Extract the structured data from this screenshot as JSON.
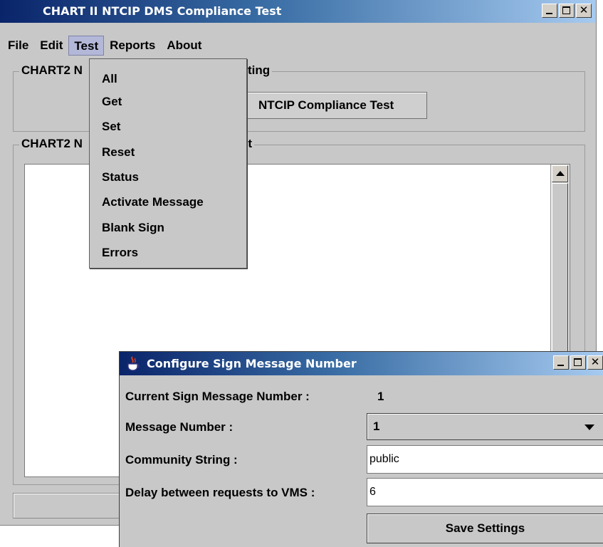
{
  "main_window": {
    "title": "CHART II NTCIP DMS Compliance Test",
    "window_controls": {
      "minimize_icon": "minimize-icon",
      "maximize_icon": "maximize-icon",
      "close_glyph": "✕"
    },
    "menubar": {
      "file": "File",
      "edit": "Edit",
      "test": "Test",
      "reports": "Reports",
      "about": "About"
    },
    "test_group_legend": "CHART2 N",
    "test_group_legend_suffix": "Testing",
    "run_button_label": "NTCIP Compliance Test",
    "output_group_legend": "CHART2 N",
    "output_group_legend_suffix": "ut"
  },
  "test_menu": {
    "items": [
      "All",
      "Get",
      "Set",
      "Reset",
      "Status",
      "Activate Message",
      "Blank Sign",
      "Errors"
    ]
  },
  "dialog": {
    "title": "Configure Sign Message Number",
    "icon": "java-cup-icon",
    "current_label": "Current Sign Message Number :",
    "current_value": "1",
    "message_number_label": "Message Number :",
    "message_number_value": "1",
    "community_label": "Community String :",
    "community_value": "public",
    "delay_label": "Delay between requests to VMS :",
    "delay_value": "6",
    "save_label": "Save Settings"
  },
  "colors": {
    "titlebar_start": "#0a246a",
    "titlebar_end": "#a6caf0",
    "window_bg": "#c8c8c8",
    "menu_highlight": "#b4b8d8"
  }
}
